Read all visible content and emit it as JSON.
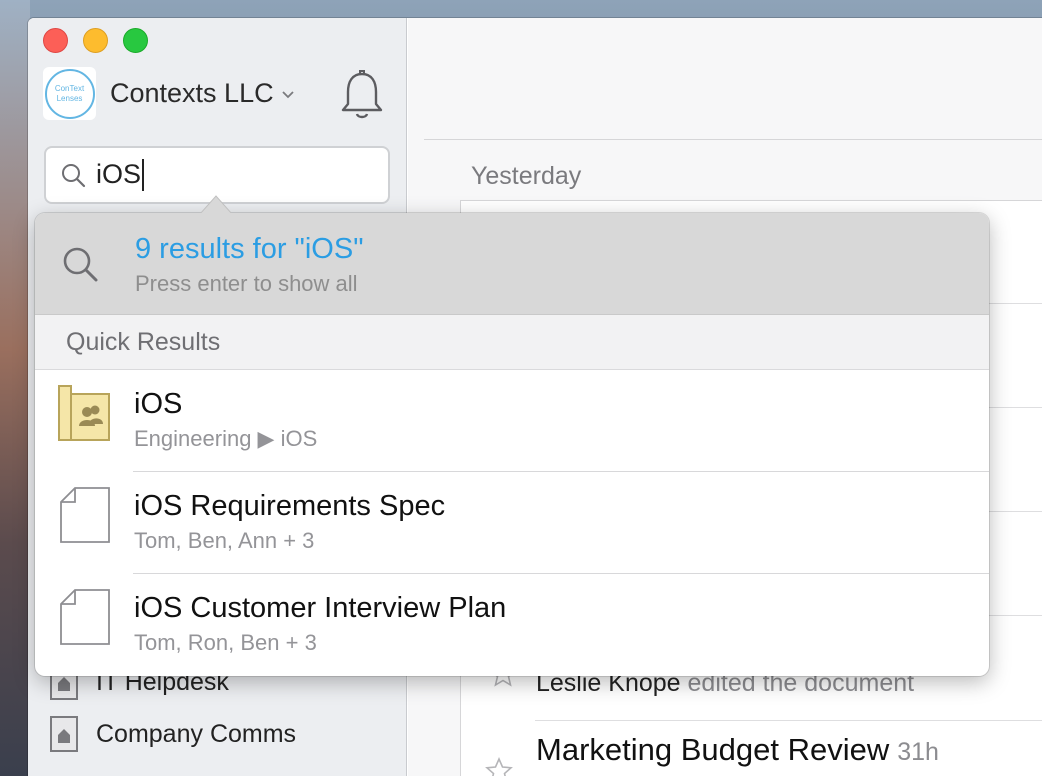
{
  "sidebar": {
    "workspace_name": "Contexts LLC",
    "logo_text_top": "ConText",
    "logo_text_bottom": "Lenses",
    "search": {
      "value": "iOS"
    },
    "nav_items": [
      {
        "label": "IT Helpdesk",
        "icon": "team-folder-icon"
      },
      {
        "label": "Company Comms",
        "icon": "team-folder-icon"
      }
    ]
  },
  "main": {
    "section_label": "Yesterday",
    "activity": {
      "actor": "Leslie Knope",
      "action": "edited the document"
    },
    "doc_title": "Marketing Budget Review",
    "doc_age": "31h"
  },
  "popover": {
    "summary_title": "9 results for \"iOS\"",
    "summary_hint": "Press enter to show all",
    "quick_results_label": "Quick Results",
    "results": [
      {
        "title": "iOS",
        "sub": "Engineering ▶ iOS",
        "icon": "team-folder-icon"
      },
      {
        "title": "iOS Requirements Spec",
        "sub": "Tom, Ben, Ann + 3",
        "icon": "document-icon"
      },
      {
        "title": "iOS Customer Interview Plan",
        "sub": "Tom, Ron, Ben + 3",
        "icon": "document-icon"
      }
    ]
  },
  "colors": {
    "accent": "#2b9de3",
    "close": "#fc5f57",
    "minimize": "#fdbc2e",
    "maximize": "#28c840"
  }
}
